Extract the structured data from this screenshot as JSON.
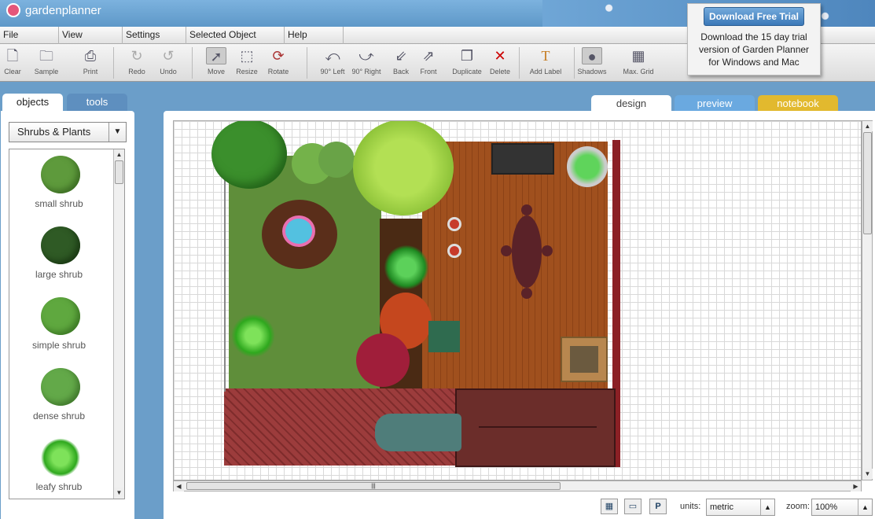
{
  "app": {
    "logo_text": "gardenplanner"
  },
  "menu": [
    {
      "label": "File",
      "w": 75
    },
    {
      "label": "View",
      "w": 81
    },
    {
      "label": "Settings",
      "w": 81
    },
    {
      "label": "Selected Object",
      "w": 125
    },
    {
      "label": "Help",
      "w": 75
    }
  ],
  "toolbar": {
    "clear": "Clear",
    "sample": "Sample",
    "print": "Print",
    "redo": "Redo",
    "undo": "Undo",
    "move": "Move",
    "resize": "Resize",
    "rotate": "Rotate",
    "rotate_left": "90° Left",
    "rotate_right": "90° Right",
    "back": "Back",
    "front": "Front",
    "duplicate": "Duplicate",
    "delete": "Delete",
    "add_label": "Add Label",
    "shadows": "Shadows",
    "max_grid": "Max. Grid"
  },
  "trial": {
    "button": "Download Free Trial",
    "text": "Download the 15 day trial version of Garden Planner for Windows and Mac"
  },
  "left_tabs": {
    "objects": "objects",
    "tools": "tools"
  },
  "right_tabs": {
    "design": "design",
    "preview": "preview",
    "notebook": "notebook"
  },
  "category": {
    "selected": "Shrubs & Plants"
  },
  "objects": [
    {
      "name": "small shrub",
      "color": "#5e9a3c"
    },
    {
      "name": "large shrub",
      "color": "#2f5a25"
    },
    {
      "name": "simple shrub",
      "color": "#5fa83f"
    },
    {
      "name": "dense shrub",
      "color": "#63a949"
    },
    {
      "name": "leafy shrub",
      "color": "#3fbf2e"
    }
  ],
  "status": {
    "units_label": "units:",
    "units_value": "metric",
    "zoom_label": "zoom:",
    "zoom_value": "100%"
  },
  "colors": {
    "tab_active": "#ffffff",
    "tab_preview": "#6aa9e0",
    "tab_notebook": "#e2b92e",
    "tab_tools": "#5e8fbf",
    "lawn": "#5f8e3a",
    "deck": "#a0501e",
    "brick": "#9c3c3c"
  }
}
